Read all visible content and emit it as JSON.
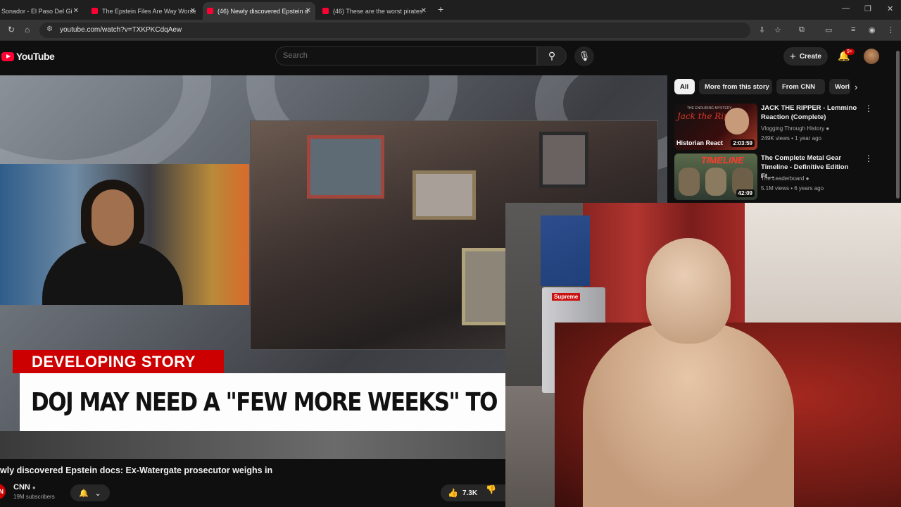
{
  "browser": {
    "tabs": [
      {
        "title": "Sonador - El Paso Del Gi",
        "active": false
      },
      {
        "title": "The Epstein Files Are Way Worse",
        "active": false
      },
      {
        "title": "(46) Newly discovered Epstein d",
        "active": true
      },
      {
        "title": "(46) These are the worst pirates",
        "active": false
      }
    ],
    "url": "youtube.com/watch?v=TXKPKCdqAew"
  },
  "youtube": {
    "logo_text": "YouTube",
    "search_placeholder": "Search",
    "create_label": "Create",
    "notification_badge": "9+"
  },
  "video": {
    "lower_third_tag": "DEVELOPING STORY",
    "lower_third_headline": "DOJ MAY NEED A \"FEW MORE WEEKS\" TO RELEASE ADDITIONAL EPSTEIN",
    "title": "wly discovered Epstein docs: Ex-Watergate prosecutor weighs in",
    "channel_name": "CNN",
    "subscribers": "19M subscribers",
    "likes": "7.3K"
  },
  "sidebar": {
    "chips": [
      "All",
      "More from this story",
      "From CNN",
      "Worl"
    ],
    "recommendations": [
      {
        "title": "JACK THE RIPPER - Lemmino Reaction (Complete)",
        "channel": "Vlogging Through History",
        "meta": "249K views • 1 year ago",
        "duration": "2:03:59",
        "thumb_text": "Historian React",
        "thumb_script": "Jack the Ripper",
        "thumb_top": "THE ENDURING MYSTERY"
      },
      {
        "title": "The Complete Metal Gear Timeline - Definitive Edition Ft....",
        "channel": "The Leaderboard",
        "meta": "5.1M views • 6 years ago",
        "duration": "42:09",
        "thumb_text": "TIMELINE"
      }
    ]
  },
  "colors": {
    "yt_red": "#ff0033",
    "cnn_red": "#cc0000",
    "bg": "#0f0f0f"
  },
  "webcam_overlay": {
    "fridge_sticker": "Supreme"
  }
}
